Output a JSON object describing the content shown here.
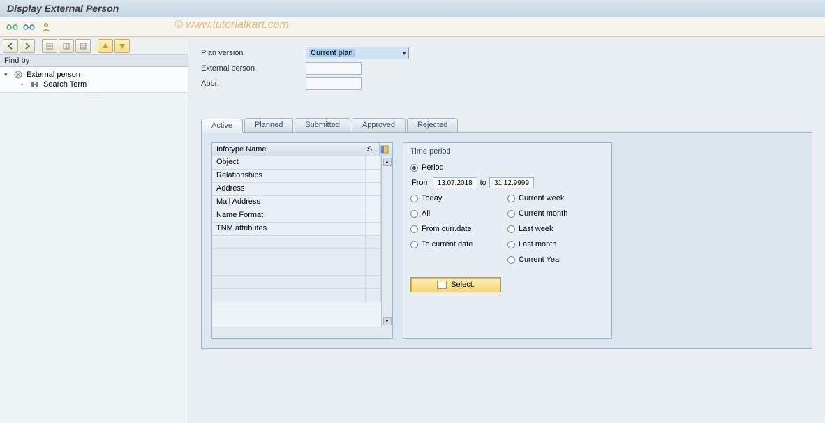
{
  "title": "Display External Person",
  "watermark": "© www.tutorialkart.com",
  "left": {
    "findby_label": "Find by",
    "tree": {
      "root": "External person",
      "child": "Search Term"
    }
  },
  "form": {
    "plan_version_label": "Plan version",
    "plan_version_value": "Current plan",
    "external_person_label": "External person",
    "external_person_value": "",
    "abbr_label": "Abbr.",
    "abbr_value": ""
  },
  "tabs": [
    "Active",
    "Planned",
    "Submitted",
    "Approved",
    "Rejected"
  ],
  "active_tab": 0,
  "infotype": {
    "col_name": "Infotype Name",
    "col_s": "S..",
    "rows": [
      "Object",
      "Relationships",
      "Address",
      "Mail Address",
      "Name Format",
      "TNM attributes"
    ]
  },
  "timeperiod": {
    "title": "Time period",
    "period": "Period",
    "from_label": "From",
    "from_value": "13.07.2018",
    "to_label": "to",
    "to_value": "31.12.9999",
    "today": "Today",
    "all": "All",
    "from_curr": "From curr.date",
    "to_curr": "To current date",
    "curr_week": "Current week",
    "curr_month": "Current month",
    "last_week": "Last week",
    "last_month": "Last month",
    "curr_year": "Current Year",
    "select_btn": "Select."
  }
}
